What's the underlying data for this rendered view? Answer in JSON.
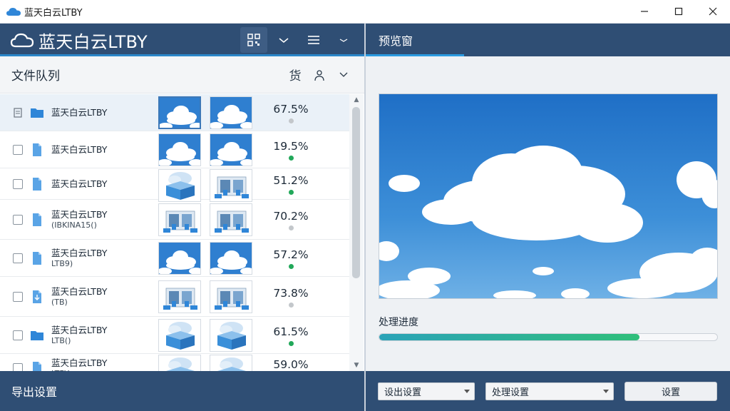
{
  "window": {
    "title": "蓝天白云LTBY",
    "controls": [
      "minimize",
      "maximize",
      "close"
    ]
  },
  "left_header": {
    "brand": "蓝天白云LTBY",
    "tools": [
      {
        "icon": "qr-code-icon",
        "active": true
      },
      {
        "icon": "chevron-down-icon",
        "active": false
      },
      {
        "icon": "hamburger-menu-icon",
        "active": false
      },
      {
        "icon": "more-icon",
        "active": false
      }
    ]
  },
  "queue": {
    "title": "文件队列",
    "tool_label": "货",
    "rows": [
      {
        "name": "蓝天白云LTBY",
        "sub": "",
        "percent": "67.5%",
        "status": "grey",
        "icon": "folder",
        "thumb_a": "sky",
        "thumb_b": "sky"
      },
      {
        "name": "蓝天白云LTBY",
        "sub": "",
        "percent": "19.5%",
        "status": "green",
        "icon": "file",
        "thumb_a": "sky",
        "thumb_b": "sky"
      },
      {
        "name": "蓝天白云LTBY",
        "sub": "",
        "percent": "51.2%",
        "status": "green",
        "icon": "file",
        "thumb_a": "box",
        "thumb_b": "building"
      },
      {
        "name": "蓝天白云LTBY",
        "sub": "(IBKINA15()",
        "percent": "70.2%",
        "status": "grey",
        "icon": "file",
        "thumb_a": "building",
        "thumb_b": "building"
      },
      {
        "name": "蓝天白云LTBY",
        "sub": "LTB9)",
        "percent": "57.2%",
        "status": "green",
        "icon": "file",
        "thumb_a": "sky",
        "thumb_b": "sky"
      },
      {
        "name": "蓝天白云LTBY",
        "sub": "(TB)",
        "percent": "73.8%",
        "status": "grey",
        "icon": "file-down",
        "thumb_a": "building",
        "thumb_b": "building"
      },
      {
        "name": "蓝天白云LTBY",
        "sub": "LTB()",
        "percent": "61.5%",
        "status": "green",
        "icon": "folder",
        "thumb_a": "box",
        "thumb_b": "box"
      },
      {
        "name": "蓝天白云LTBY",
        "sub": "LTBY",
        "percent": "59.0%",
        "status": "green",
        "icon": "file",
        "thumb_a": "box",
        "thumb_b": "box"
      }
    ]
  },
  "preview": {
    "title": "预览窗",
    "progress_label": "处理进度",
    "progress_value": 0.77
  },
  "footer": {
    "export_label": "导出设置",
    "select1": "设出设置",
    "select2": "处理设置",
    "button": "设置"
  },
  "colors": {
    "header_bg": "#2f4e74",
    "accent": "#2b9be0",
    "status_green": "#22a85a",
    "status_grey": "#c3c7cb",
    "folder_blue": "#2f86d8"
  }
}
